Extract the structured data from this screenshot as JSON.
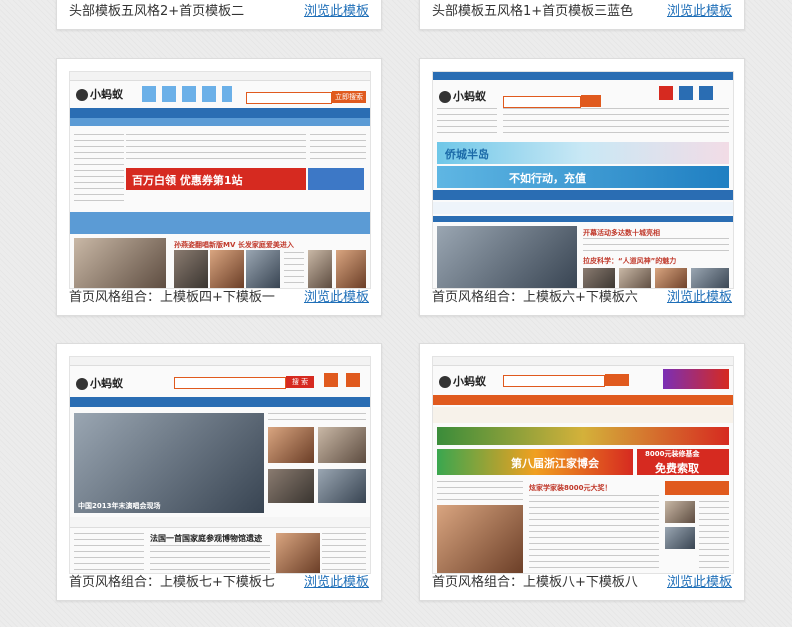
{
  "cards": [
    {
      "caption": "头部模板五风格2+首页模板二",
      "link": "浏览此模板"
    },
    {
      "caption": "头部模板五风格1+首页模板三蓝色",
      "link": "浏览此模板"
    },
    {
      "caption": "首页风格组合：上模板四+下模板一",
      "link": "浏览此模板"
    },
    {
      "caption": "首页风格组合：上模板六+下模板六",
      "link": "浏览此模板"
    },
    {
      "caption": "首页风格组合：上模板七+下模板七",
      "link": "浏览此模板"
    },
    {
      "caption": "首页风格组合：上模板八+下模板八",
      "link": "浏览此模板"
    }
  ],
  "thumbs": {
    "logo": "小蚂蚁",
    "search_button": "立即搜索",
    "t1_banner": "百万白领 优惠券第1站",
    "t1_headline": "孙燕姿翻唱新版MV 长发家庭爱美进入",
    "t2_banner": "侨城半岛",
    "t2_banner2": "不如行动，充值",
    "t2_headline": "开幕活动多达数十城亮相",
    "t2_headline2": "拉皮科学：“人道风神”的魅力",
    "t3_search_button": "搜 索",
    "t3_caption": "中国2013年末演唱会现场",
    "t3_headline": "法国一首国家庭参观博物馆遗迹",
    "t4_banner": "第八届浙江家博会",
    "t4_banner2": "免费索取",
    "t4_promo": "8000元装修基金",
    "t4_headline": "炫家学家装8000元大奖！"
  },
  "colors": {
    "link": "#1f6fb8",
    "orange": "#e05a1e",
    "blue_nav": "#2a6db3",
    "red": "#d62a20"
  }
}
